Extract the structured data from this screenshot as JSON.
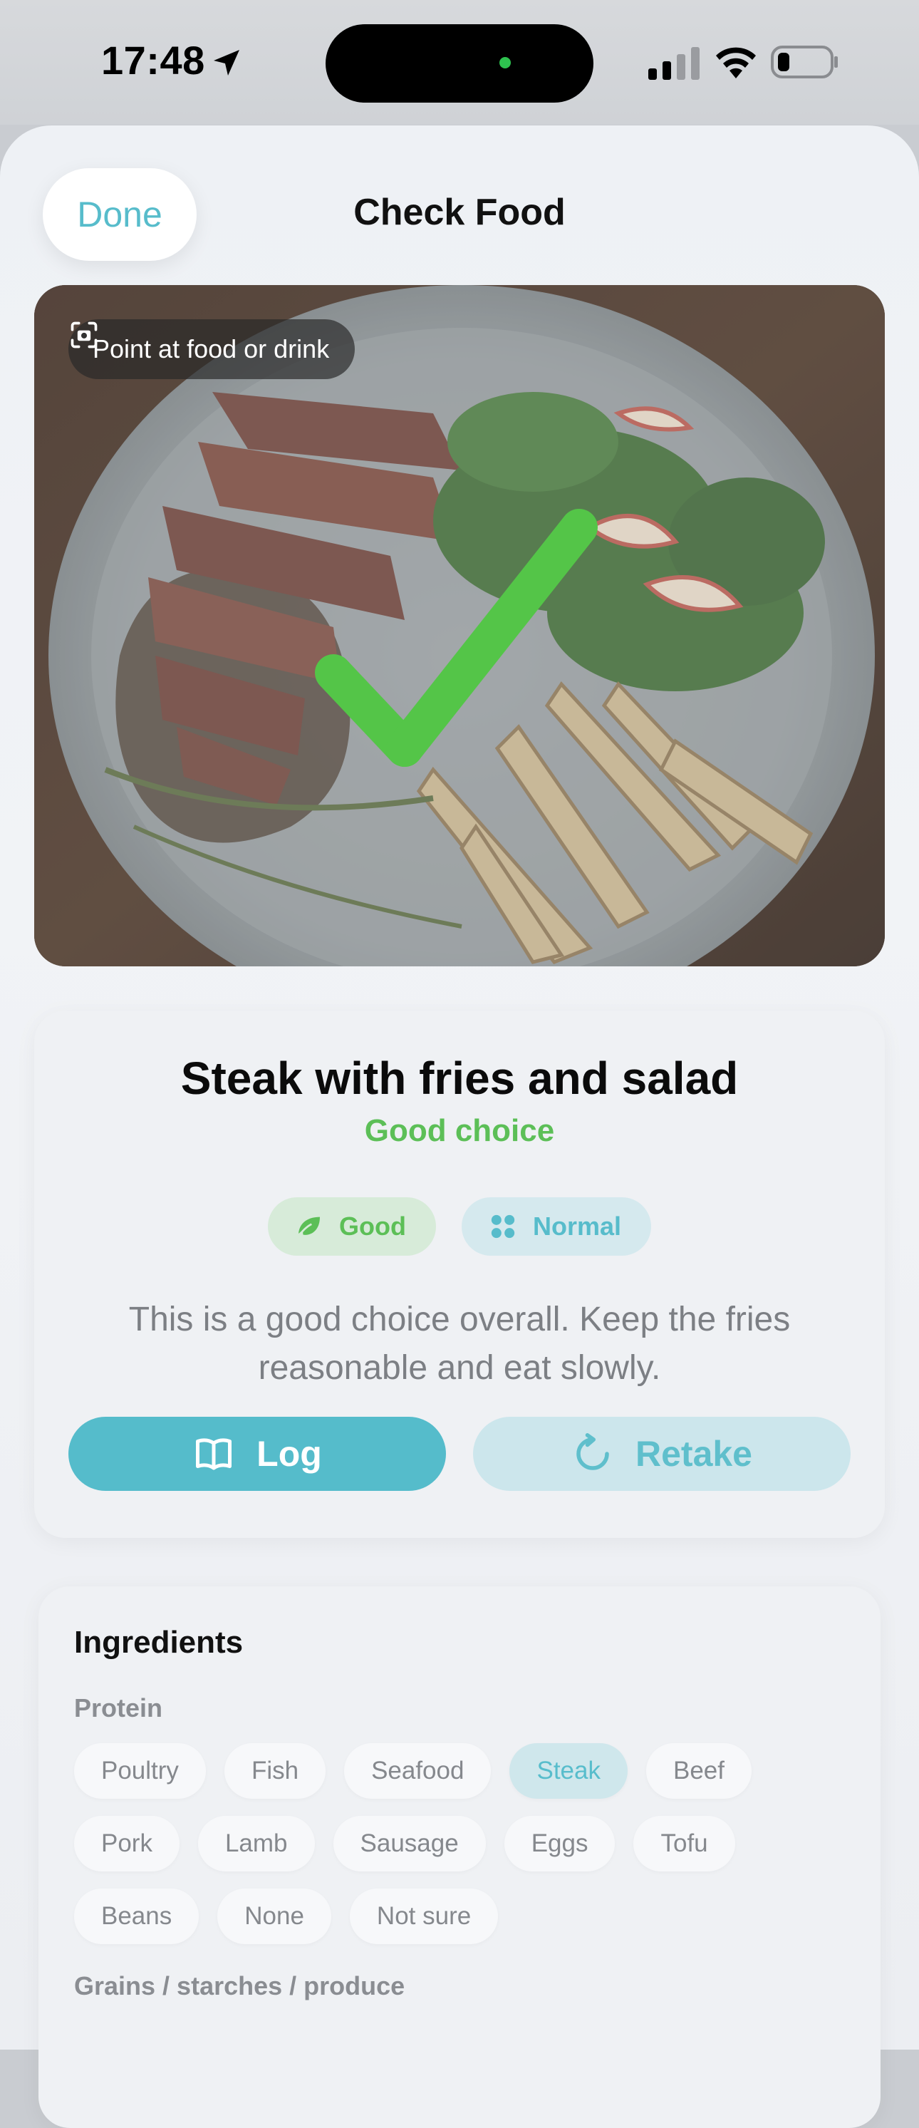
{
  "status_bar": {
    "time": "17:48"
  },
  "header": {
    "done_label": "Done",
    "title": "Check Food"
  },
  "camera": {
    "hint": "Point at food or drink"
  },
  "result": {
    "food_name": "Steak with fries and salad",
    "verdict": "Good choice",
    "badges": [
      {
        "label": "Good",
        "icon": "leaf-icon"
      },
      {
        "label": "Normal",
        "icon": "grid-dots-icon"
      }
    ],
    "description": "This is a good choice overall. Keep the fries reasonable and eat slowly.",
    "log_label": "Log",
    "retake_label": "Retake"
  },
  "ingredients": {
    "title": "Ingredients",
    "groups": [
      {
        "label": "Protein",
        "items": [
          "Poultry",
          "Fish",
          "Seafood",
          "Steak",
          "Beef",
          "Pork",
          "Lamb",
          "Sausage",
          "Eggs",
          "Tofu",
          "Beans",
          "None",
          "Not sure"
        ],
        "selected": "Steak"
      },
      {
        "label": "Grains / starches / produce"
      }
    ]
  },
  "colors": {
    "accent": "#55bccb",
    "good": "#5cbf57",
    "text_secondary": "#7c7f84"
  }
}
